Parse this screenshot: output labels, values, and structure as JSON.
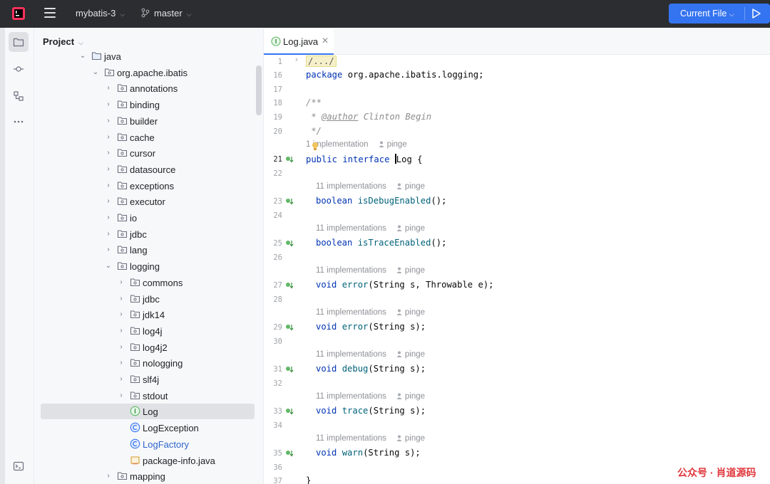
{
  "titlebar": {
    "project_name": "mybatis-3",
    "branch": "master",
    "run_config": "Current File"
  },
  "project_panel": {
    "title": "Project",
    "tree": [
      {
        "label": "java",
        "depth": 0,
        "type": "folder-src",
        "arrow": "open"
      },
      {
        "label": "org.apache.ibatis",
        "depth": 1,
        "type": "package",
        "arrow": "open"
      },
      {
        "label": "annotations",
        "depth": 2,
        "type": "package",
        "arrow": "closed"
      },
      {
        "label": "binding",
        "depth": 2,
        "type": "package",
        "arrow": "closed"
      },
      {
        "label": "builder",
        "depth": 2,
        "type": "package",
        "arrow": "closed"
      },
      {
        "label": "cache",
        "depth": 2,
        "type": "package",
        "arrow": "closed"
      },
      {
        "label": "cursor",
        "depth": 2,
        "type": "package",
        "arrow": "closed"
      },
      {
        "label": "datasource",
        "depth": 2,
        "type": "package",
        "arrow": "closed"
      },
      {
        "label": "exceptions",
        "depth": 2,
        "type": "package",
        "arrow": "closed"
      },
      {
        "label": "executor",
        "depth": 2,
        "type": "package",
        "arrow": "closed"
      },
      {
        "label": "io",
        "depth": 2,
        "type": "package",
        "arrow": "closed"
      },
      {
        "label": "jdbc",
        "depth": 2,
        "type": "package",
        "arrow": "closed"
      },
      {
        "label": "lang",
        "depth": 2,
        "type": "package",
        "arrow": "closed"
      },
      {
        "label": "logging",
        "depth": 2,
        "type": "package",
        "arrow": "open"
      },
      {
        "label": "commons",
        "depth": 3,
        "type": "package",
        "arrow": "closed"
      },
      {
        "label": "jdbc",
        "depth": 3,
        "type": "package",
        "arrow": "closed"
      },
      {
        "label": "jdk14",
        "depth": 3,
        "type": "package",
        "arrow": "closed"
      },
      {
        "label": "log4j",
        "depth": 3,
        "type": "package",
        "arrow": "closed"
      },
      {
        "label": "log4j2",
        "depth": 3,
        "type": "package",
        "arrow": "closed"
      },
      {
        "label": "nologging",
        "depth": 3,
        "type": "package",
        "arrow": "closed"
      },
      {
        "label": "slf4j",
        "depth": 3,
        "type": "package",
        "arrow": "closed"
      },
      {
        "label": "stdout",
        "depth": 3,
        "type": "package",
        "arrow": "closed"
      },
      {
        "label": "Log",
        "depth": 3,
        "type": "interface",
        "arrow": "none",
        "selected": true
      },
      {
        "label": "LogException",
        "depth": 3,
        "type": "class",
        "arrow": "none"
      },
      {
        "label": "LogFactory",
        "depth": 3,
        "type": "class",
        "arrow": "none",
        "blue": true
      },
      {
        "label": "package-info.java",
        "depth": 3,
        "type": "java-file",
        "arrow": "none"
      },
      {
        "label": "mapping",
        "depth": 2,
        "type": "package",
        "arrow": "closed"
      }
    ]
  },
  "editor": {
    "tab_label": "Log.java",
    "folded_text": "/.../",
    "hint_impl_top": "1 implementation",
    "hint_impl": "11 implementations",
    "hint_author": "pinge",
    "lines": {
      "l1": "1",
      "l16": "16",
      "l17": "17",
      "l18": "18",
      "l19": "19",
      "l20": "20",
      "l21": "21",
      "l22": "22",
      "l23": "23",
      "l24": "24",
      "l25": "25",
      "l26": "26",
      "l27": "27",
      "l28": "28",
      "l29": "29",
      "l30": "30",
      "l31": "31",
      "l32": "32",
      "l33": "33",
      "l34": "34",
      "l35": "35",
      "l36": "36",
      "l37": "37"
    },
    "code": {
      "package_kw": "package",
      "package_name": " org.apache.ibatis.logging;",
      "doc_open": "/**",
      "doc_star": " * ",
      "doc_tag": "@author",
      "doc_author": " Clinton Begin",
      "doc_close": " */",
      "public_kw": "public",
      "interface_kw": "interface",
      "iface_name_a": "L",
      "iface_name_b": "og {",
      "boolean_kw": "boolean",
      "void_kw": "void",
      "m_isDebugEnabled": "isDebugEnabled",
      "m_isTraceEnabled": "isTraceEnabled",
      "m_error": "error",
      "m_debug": "debug",
      "m_trace": "trace",
      "m_warn": "warn",
      "empty_args": "();",
      "args_error_throwable": "(String s, Throwable e);",
      "args_string": "(String s);",
      "close_brace": "}"
    }
  },
  "watermark": "公众号 · 肖道源码"
}
